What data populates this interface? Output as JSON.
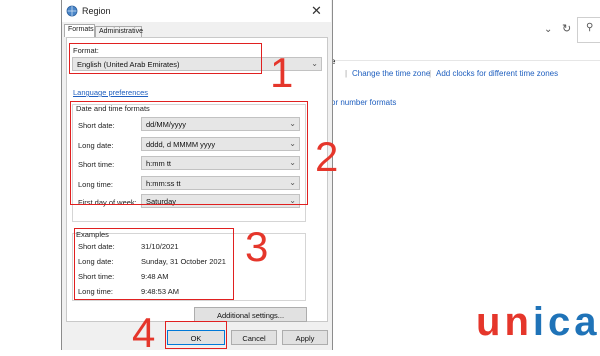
{
  "dialog": {
    "title": "Region",
    "tabs": [
      "Formats",
      "Administrative"
    ],
    "format_label": "Format:",
    "format_value": "English (United Arab Emirates)",
    "language_link": "Language preferences",
    "date_time_group": "Date and time formats",
    "fields": [
      {
        "label": "Short date:",
        "value": "dd/MM/yyyy"
      },
      {
        "label": "Long date:",
        "value": "dddd, d MMMM yyyy"
      },
      {
        "label": "Short time:",
        "value": "h:mm tt"
      },
      {
        "label": "Long time:",
        "value": "h:mm:ss tt"
      },
      {
        "label": "First day of week:",
        "value": "Saturday"
      }
    ],
    "examples_group": "Examples",
    "examples": [
      {
        "label": "Short date:",
        "value": "31/10/2021"
      },
      {
        "label": "Long date:",
        "value": "Sunday, 31 October 2021"
      },
      {
        "label": "Short time:",
        "value": "9:48 AM"
      },
      {
        "label": "Long time:",
        "value": "9:48:53 AM"
      }
    ],
    "additional_settings": "Additional settings...",
    "ok": "OK",
    "cancel": "Cancel",
    "apply": "Apply"
  },
  "background": {
    "links": [
      "Change the time zone",
      "Add clocks for different time zones"
    ],
    "number_formats_link": "or number formats",
    "partial_letter": "e"
  },
  "annotations": [
    "1",
    "2",
    "3",
    "4"
  ],
  "logo": {
    "text": "unica",
    "colors": {
      "u": "#e5362b",
      "n": "#e5362b",
      "i": "#1f73b8",
      "c": "#1f73b8",
      "a": "#1f73b8"
    }
  },
  "colors": {
    "annotation_red": "#e5362b",
    "link_blue": "#1f5fbf"
  }
}
